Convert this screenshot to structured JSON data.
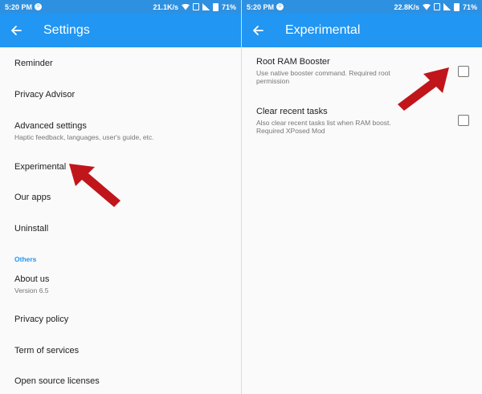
{
  "colors": {
    "appbar": "#2196f3",
    "statusbar": "#2e90e0",
    "accent": "#2196f3",
    "arrow": "#c0161b"
  },
  "left": {
    "status": {
      "time": "5:20 PM",
      "speed": "21.1K/s",
      "battery": "71%"
    },
    "title": "Settings",
    "items": [
      {
        "label": "Reminder",
        "sub": ""
      },
      {
        "label": "Privacy Advisor",
        "sub": ""
      },
      {
        "label": "Advanced settings",
        "sub": "Haptic feedback, languages, user's guide, etc."
      },
      {
        "label": "Experimental",
        "sub": ""
      },
      {
        "label": "Our apps",
        "sub": ""
      },
      {
        "label": "Uninstall",
        "sub": ""
      }
    ],
    "section": "Others",
    "others": [
      {
        "label": "About us",
        "sub": "Version 6.5"
      },
      {
        "label": "Privacy policy",
        "sub": ""
      },
      {
        "label": "Term of services",
        "sub": ""
      },
      {
        "label": "Open source licenses",
        "sub": ""
      }
    ]
  },
  "right": {
    "status": {
      "time": "5:20 PM",
      "speed": "22.8K/s",
      "battery": "71%"
    },
    "title": "Experimental",
    "items": [
      {
        "label": "Root RAM Booster",
        "sub": "Use native booster command. Required root permission",
        "checked": false
      },
      {
        "label": "Clear recent tasks",
        "sub": "Also clear recent tasks list when RAM boost. Required XPosed Mod",
        "checked": false
      }
    ]
  }
}
